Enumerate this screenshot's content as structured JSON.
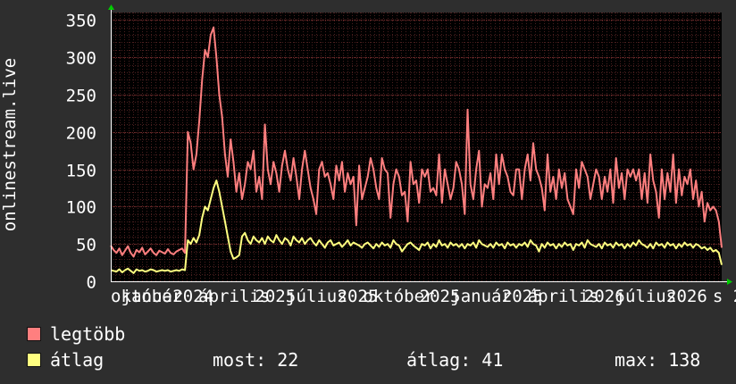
{
  "chart_data": {
    "type": "line",
    "ylabel": "onlinestream.live",
    "ylim": [
      0,
      360
    ],
    "yticks": [
      0,
      50,
      100,
      150,
      200,
      250,
      300,
      350
    ],
    "grid": true,
    "x_tick_labels": [
      "október",
      "január",
      "2024",
      "április",
      "2025",
      "július",
      "2025",
      "október",
      "2025",
      "január",
      "2025",
      "április",
      "2026",
      "július",
      "2026",
      "s 2"
    ],
    "x_months": [
      "2023-10",
      "2024-01",
      "2024-04",
      "2024-07",
      "2024-10",
      "2025-01",
      "2025-04",
      "2025-07",
      "2025-10",
      "2026-01",
      "2026-04"
    ],
    "legend_position": "bottom-left",
    "series": [
      {
        "name": "legtöbb",
        "color": "#ff7f7f",
        "values": [
          48,
          42,
          38,
          44,
          35,
          41,
          47,
          38,
          33,
          42,
          39,
          45,
          36,
          40,
          44,
          38,
          35,
          41,
          39,
          37,
          43,
          38,
          36,
          40,
          42,
          44,
          38,
          200,
          185,
          150,
          170,
          215,
          270,
          310,
          300,
          330,
          340,
          300,
          250,
          220,
          170,
          140,
          190,
          160,
          120,
          145,
          110,
          130,
          160,
          150,
          175,
          120,
          140,
          110,
          210,
          150,
          130,
          160,
          145,
          120,
          155,
          175,
          150,
          135,
          165,
          140,
          110,
          150,
          175,
          150,
          125,
          110,
          90,
          150,
          160,
          140,
          145,
          130,
          110,
          155,
          135,
          160,
          120,
          145,
          130,
          140,
          75,
          155,
          110,
          125,
          140,
          165,
          150,
          125,
          110,
          165,
          150,
          145,
          85,
          130,
          150,
          140,
          115,
          120,
          80,
          160,
          130,
          135,
          105,
          150,
          140,
          150,
          120,
          125,
          115,
          170,
          105,
          150,
          130,
          110,
          125,
          160,
          150,
          130,
          90,
          230,
          130,
          110,
          150,
          175,
          100,
          130,
          125,
          145,
          110,
          170,
          130,
          170,
          150,
          140,
          120,
          115,
          150,
          150,
          110,
          150,
          170,
          135,
          185,
          150,
          140,
          125,
          95,
          170,
          120,
          140,
          110,
          150,
          125,
          145,
          110,
          100,
          90,
          150,
          125,
          160,
          150,
          140,
          110,
          130,
          150,
          140,
          110,
          140,
          120,
          150,
          105,
          165,
          125,
          145,
          110,
          150,
          140,
          150,
          135,
          150,
          110,
          145,
          105,
          170,
          135,
          120,
          85,
          150,
          110,
          145,
          120,
          170,
          105,
          150,
          115,
          140,
          130,
          150,
          110,
          135,
          100,
          120,
          80,
          105,
          95,
          100,
          95,
          80,
          45
        ]
      },
      {
        "name": "átlag",
        "color": "#ffff80",
        "values": [
          15,
          14,
          13,
          16,
          12,
          15,
          17,
          14,
          11,
          16,
          14,
          15,
          13,
          14,
          16,
          15,
          13,
          14,
          15,
          14,
          15,
          13,
          14,
          15,
          14,
          16,
          15,
          55,
          50,
          58,
          52,
          62,
          85,
          100,
          95,
          110,
          125,
          135,
          120,
          100,
          80,
          60,
          40,
          30,
          32,
          35,
          60,
          65,
          55,
          50,
          60,
          55,
          52,
          58,
          50,
          60,
          55,
          52,
          62,
          55,
          50,
          58,
          55,
          48,
          60,
          55,
          52,
          58,
          50,
          55,
          58,
          52,
          48,
          55,
          50,
          45,
          52,
          55,
          48,
          50,
          52,
          46,
          50,
          55,
          48,
          52,
          50,
          48,
          45,
          50,
          52,
          48,
          44,
          50,
          46,
          52,
          48,
          50,
          45,
          55,
          50,
          48,
          40,
          45,
          50,
          52,
          48,
          45,
          42,
          50,
          48,
          52,
          44,
          50,
          46,
          55,
          48,
          50,
          45,
          52,
          48,
          50,
          46,
          50,
          44,
          50,
          48,
          52,
          45,
          55,
          50,
          48,
          46,
          50,
          45,
          52,
          48,
          50,
          44,
          52,
          48,
          50,
          45,
          50,
          48,
          52,
          46,
          55,
          50,
          48,
          40,
          50,
          45,
          52,
          48,
          50,
          44,
          50,
          46,
          52,
          48,
          50,
          42,
          50,
          48,
          52,
          45,
          55,
          50,
          48,
          46,
          50,
          44,
          52,
          48,
          50,
          45,
          52,
          48,
          50,
          44,
          50,
          46,
          52,
          48,
          55,
          50,
          48,
          45,
          50,
          44,
          52,
          48,
          50,
          45,
          52,
          48,
          50,
          44,
          50,
          46,
          52,
          48,
          50,
          45,
          50,
          48,
          44,
          46,
          42,
          45,
          40,
          42,
          38,
          22
        ]
      }
    ],
    "stats": {
      "most_label": "most:",
      "most_value": "22",
      "avg_label": "átlag:",
      "avg_value": "41",
      "max_label": "max:",
      "max_value": "138"
    }
  }
}
